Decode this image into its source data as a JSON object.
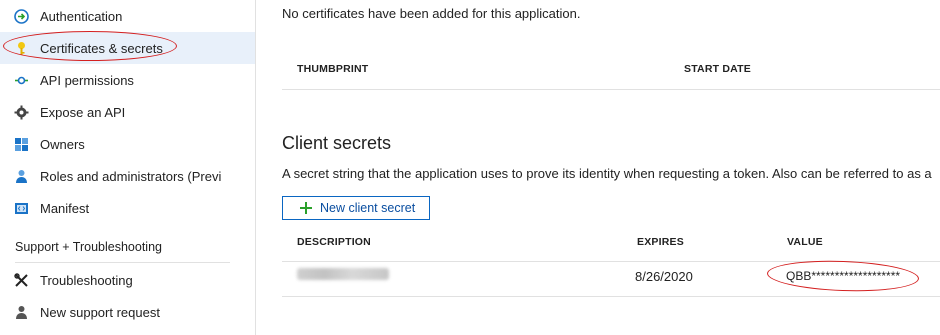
{
  "sidebar": {
    "items": [
      {
        "label": "Authentication",
        "icon": "authentication-icon"
      },
      {
        "label": "Certificates & secrets",
        "icon": "key-icon"
      },
      {
        "label": "API permissions",
        "icon": "api-permissions-icon"
      },
      {
        "label": "Expose an API",
        "icon": "cloud-gear-icon"
      },
      {
        "label": "Owners",
        "icon": "owners-icon"
      },
      {
        "label": "Roles and administrators (Previ",
        "icon": "roles-icon"
      },
      {
        "label": "Manifest",
        "icon": "manifest-icon"
      }
    ],
    "support_header": "Support + Troubleshooting",
    "support_items": [
      {
        "label": "Troubleshooting",
        "icon": "wrench-icon"
      },
      {
        "label": "New support request",
        "icon": "person-support-icon"
      }
    ]
  },
  "certificates": {
    "empty_message": "No certificates have been added for this application.",
    "columns": [
      "THUMBPRINT",
      "START DATE"
    ]
  },
  "client_secrets": {
    "title": "Client secrets",
    "description": "A secret string that the application uses to prove its identity when requesting a token. Also can be referred to as a",
    "new_button_label": "New client secret",
    "columns": [
      "DESCRIPTION",
      "EXPIRES",
      "VALUE"
    ],
    "rows": [
      {
        "description": "",
        "expires": "8/26/2020",
        "value": "QBB*******************"
      }
    ]
  },
  "colors": {
    "accent": "#0a66c2",
    "highlight": "#d42020",
    "selected_bg": "#e8f0fa"
  }
}
